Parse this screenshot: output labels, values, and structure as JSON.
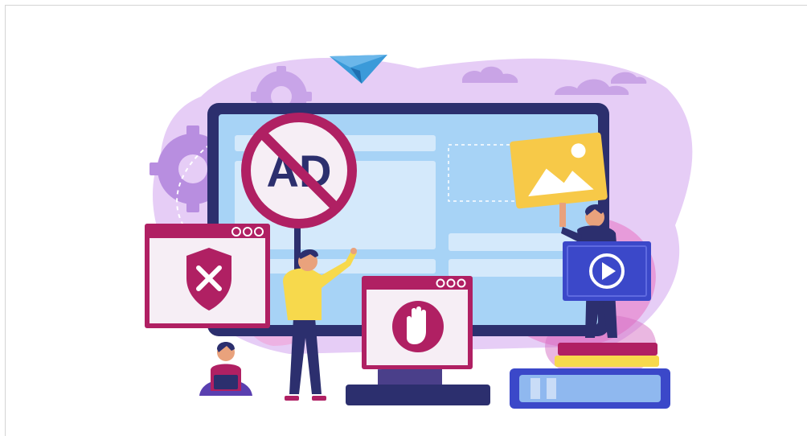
{
  "illustration": {
    "sign_text": "AD",
    "colors": {
      "blob_purple": "#d9b8f0",
      "blob_pink": "#f3c9e6",
      "monitor_dark": "#2c2f6e",
      "screen_blue": "#a7d3f6",
      "crimson": "#b02063",
      "window_light": "#f6eef5",
      "yellow": "#f7c948",
      "video_blue": "#3b48c9",
      "paper_plane": "#3b9ad9"
    },
    "icons": [
      "paper-plane-icon",
      "gear-icon",
      "no-ad-sign-icon",
      "shield-x-icon",
      "stop-hand-icon",
      "image-icon",
      "play-icon",
      "book-stack-icon",
      "cloud-icon"
    ]
  }
}
